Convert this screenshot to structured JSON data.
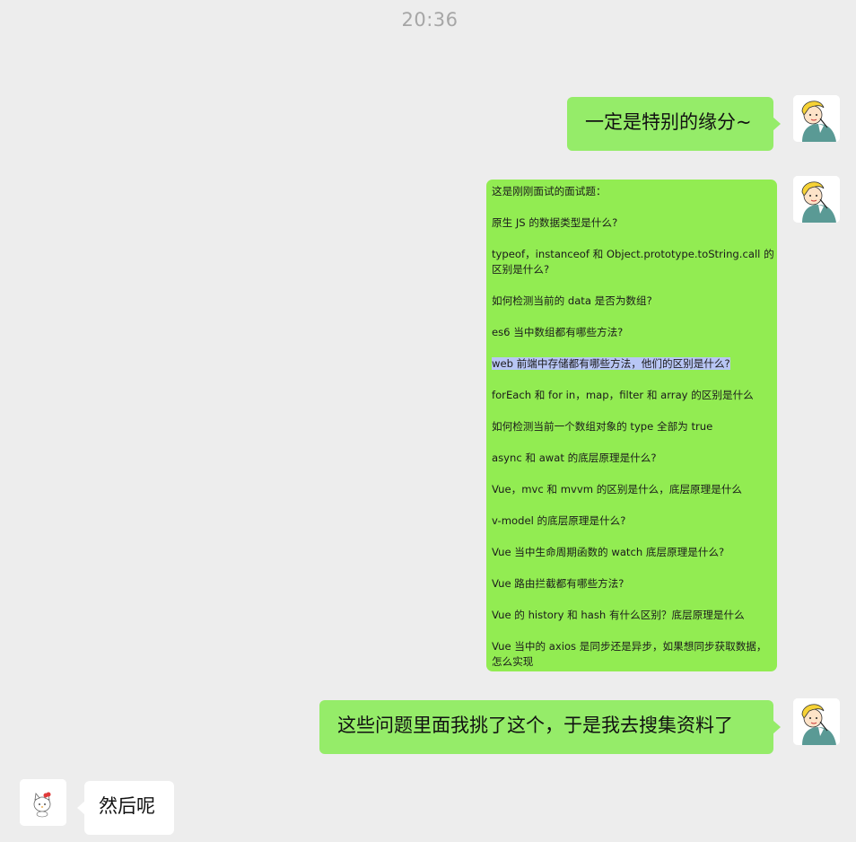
{
  "chat": {
    "timestamp": "20:36",
    "messages": [
      {
        "sender": "me",
        "type": "text",
        "text": "一定是特别的缘分~"
      },
      {
        "sender": "me",
        "type": "image",
        "lines": [
          "这是刚刚面试的面试题：",
          "原生 JS 的数据类型是什么?",
          "typeof，instanceof 和 Object.prototype.toString.call 的区别是什么?",
          "如何检测当前的 data 是否为数组?",
          "es6 当中数组都有哪些方法?",
          "web 前端中存储都有哪些方法，他们的区别是什么?",
          "forEach 和 for in，map，filter 和 array 的区别是什么",
          "如何检测当前一个数组对象的 type 全部为 true",
          "async 和 awat 的底层原理是什么?",
          "Vue，mvc 和 mvvm 的区别是什么，底层原理是什么",
          "v-model 的底层原理是什么?",
          "Vue 当中生命周期函数的 watch 底层原理是什么?",
          "Vue 路由拦截都有哪些方法?",
          "Vue 的 history 和 hash 有什么区别？底层原理是什么",
          "Vue 当中的 axios 是同步还是异步，如果想同步获取数据，怎么实现"
        ],
        "highlighted_index": 5
      },
      {
        "sender": "me",
        "type": "text",
        "text": "这些问题里面我挑了这个，于是我去搜集资料了"
      },
      {
        "sender": "other",
        "type": "text",
        "text": "然后呢"
      }
    ]
  },
  "colors": {
    "background": "#ededed",
    "sent_bubble": "#95ec69",
    "received_bubble": "#ffffff",
    "timestamp": "#a6a6a6",
    "highlight": "#b8c6f5"
  },
  "icons": {
    "my_avatar": "cartoon-person-avatar-icon",
    "other_avatar": "cartoon-cat-avatar-icon"
  }
}
